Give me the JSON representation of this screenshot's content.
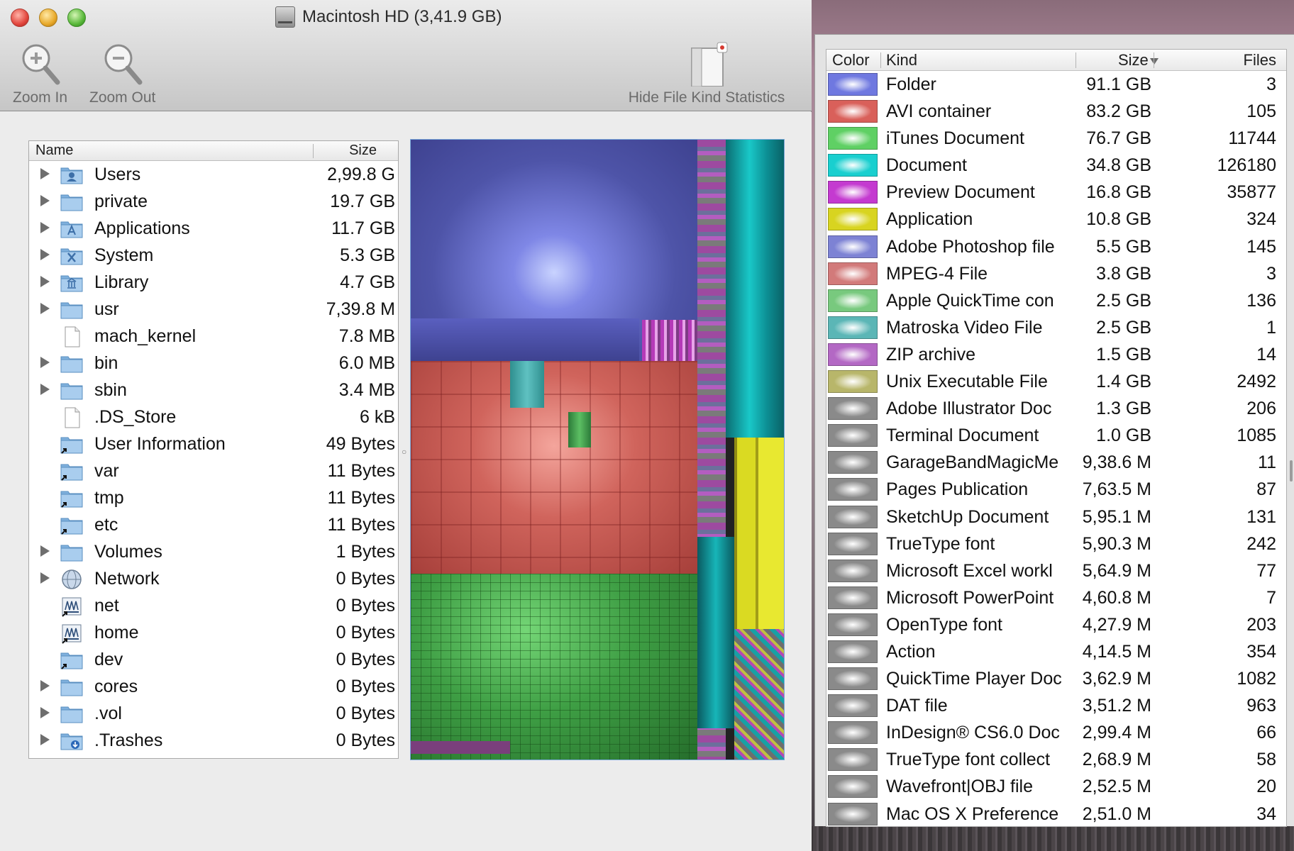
{
  "window": {
    "title": "Macintosh HD (3,41.9 GB)"
  },
  "toolbar": {
    "zoom_in_label": "Zoom In",
    "zoom_out_label": "Zoom Out",
    "hide_stats_label": "Hide File Kind Statistics"
  },
  "file_list": {
    "header_name": "Name",
    "header_size": "Size",
    "rows": [
      {
        "name": "Users",
        "size": "2,99.8 G",
        "expandable": true,
        "icon": "users-folder-icon"
      },
      {
        "name": "private",
        "size": "19.7 GB",
        "expandable": true,
        "icon": "folder-icon"
      },
      {
        "name": "Applications",
        "size": "11.7 GB",
        "expandable": true,
        "icon": "applications-folder-icon"
      },
      {
        "name": "System",
        "size": "5.3 GB",
        "expandable": true,
        "icon": "system-folder-icon"
      },
      {
        "name": "Library",
        "size": "4.7 GB",
        "expandable": true,
        "icon": "library-folder-icon"
      },
      {
        "name": "usr",
        "size": "7,39.8 M",
        "expandable": true,
        "icon": "folder-icon"
      },
      {
        "name": "mach_kernel",
        "size": "7.8 MB",
        "expandable": false,
        "icon": "document-icon"
      },
      {
        "name": "bin",
        "size": "6.0 MB",
        "expandable": true,
        "icon": "folder-icon"
      },
      {
        "name": "sbin",
        "size": "3.4 MB",
        "expandable": true,
        "icon": "folder-icon"
      },
      {
        "name": ".DS_Store",
        "size": "6 kB",
        "expandable": false,
        "icon": "document-icon"
      },
      {
        "name": "User Information",
        "size": "49 Bytes",
        "expandable": false,
        "icon": "alias-folder-icon"
      },
      {
        "name": "var",
        "size": "11 Bytes",
        "expandable": false,
        "icon": "alias-folder-icon"
      },
      {
        "name": "tmp",
        "size": "11 Bytes",
        "expandable": false,
        "icon": "alias-folder-icon"
      },
      {
        "name": "etc",
        "size": "11 Bytes",
        "expandable": false,
        "icon": "alias-folder-icon"
      },
      {
        "name": "Volumes",
        "size": "1 Bytes",
        "expandable": true,
        "icon": "folder-icon"
      },
      {
        "name": "Network",
        "size": "0 Bytes",
        "expandable": true,
        "icon": "network-globe-icon"
      },
      {
        "name": "net",
        "size": "0 Bytes",
        "expandable": false,
        "icon": "network-share-icon"
      },
      {
        "name": "home",
        "size": "0 Bytes",
        "expandable": false,
        "icon": "network-share-icon"
      },
      {
        "name": "dev",
        "size": "0 Bytes",
        "expandable": false,
        "icon": "alias-folder-icon"
      },
      {
        "name": "cores",
        "size": "0 Bytes",
        "expandable": true,
        "icon": "folder-icon"
      },
      {
        "name": ".vol",
        "size": "0 Bytes",
        "expandable": true,
        "icon": "folder-icon"
      },
      {
        "name": ".Trashes",
        "size": "0 Bytes",
        "expandable": true,
        "icon": "trash-folder-icon"
      }
    ]
  },
  "stats": {
    "header_color": "Color",
    "header_kind": "Kind",
    "header_size": "Size",
    "header_files": "Files",
    "rows": [
      {
        "color": "#6f78e0",
        "kind": "Folder",
        "size": "91.1 GB",
        "files": "3"
      },
      {
        "color": "#d9605a",
        "kind": "AVI container",
        "size": "83.2 GB",
        "files": "105"
      },
      {
        "color": "#5fd064",
        "kind": "iTunes Document",
        "size": "76.7 GB",
        "files": "11744"
      },
      {
        "color": "#19cfcf",
        "kind": "Document",
        "size": "34.8 GB",
        "files": "126180"
      },
      {
        "color": "#c43ad0",
        "kind": "Preview Document",
        "size": "16.8 GB",
        "files": "35877"
      },
      {
        "color": "#d8d420",
        "kind": "Application",
        "size": "10.8 GB",
        "files": "324"
      },
      {
        "color": "#7d82d4",
        "kind": "Adobe Photoshop file",
        "size": "5.5 GB",
        "files": "145"
      },
      {
        "color": "#d27a7a",
        "kind": "MPEG-4 File",
        "size": "3.8 GB",
        "files": "3"
      },
      {
        "color": "#78c97e",
        "kind": "Apple QuickTime con",
        "size": "2.5 GB",
        "files": "136"
      },
      {
        "color": "#5bb6b6",
        "kind": "Matroska Video File",
        "size": "2.5 GB",
        "files": "1"
      },
      {
        "color": "#b368c4",
        "kind": "ZIP archive",
        "size": "1.5 GB",
        "files": "14"
      },
      {
        "color": "#b8b66a",
        "kind": "Unix Executable File",
        "size": "1.4 GB",
        "files": "2492"
      },
      {
        "color": "#8a8a8a",
        "kind": "Adobe Illustrator Doc",
        "size": "1.3 GB",
        "files": "206"
      },
      {
        "color": "#8a8a8a",
        "kind": "Terminal Document",
        "size": "1.0 GB",
        "files": "1085"
      },
      {
        "color": "#8a8a8a",
        "kind": "GarageBandMagicMe",
        "size": "9,38.6 M",
        "files": "11"
      },
      {
        "color": "#8a8a8a",
        "kind": "Pages Publication",
        "size": "7,63.5 M",
        "files": "87"
      },
      {
        "color": "#8a8a8a",
        "kind": "SketchUp Document",
        "size": "5,95.1 M",
        "files": "131"
      },
      {
        "color": "#8a8a8a",
        "kind": "TrueType font",
        "size": "5,90.3 M",
        "files": "242"
      },
      {
        "color": "#8a8a8a",
        "kind": "Microsoft Excel workl",
        "size": "5,64.9 M",
        "files": "77"
      },
      {
        "color": "#8a8a8a",
        "kind": "Microsoft PowerPoint",
        "size": "4,60.8 M",
        "files": "7"
      },
      {
        "color": "#8a8a8a",
        "kind": "OpenType font",
        "size": "4,27.9 M",
        "files": "203"
      },
      {
        "color": "#8a8a8a",
        "kind": "Action",
        "size": "4,14.5 M",
        "files": "354"
      },
      {
        "color": "#8a8a8a",
        "kind": "QuickTime Player Doc",
        "size": "3,62.9 M",
        "files": "1082"
      },
      {
        "color": "#8a8a8a",
        "kind": "DAT file",
        "size": "3,51.2 M",
        "files": "963"
      },
      {
        "color": "#8a8a8a",
        "kind": "InDesign® CS6.0 Doc",
        "size": "2,99.4 M",
        "files": "66"
      },
      {
        "color": "#8a8a8a",
        "kind": "TrueType font collect",
        "size": "2,68.9 M",
        "files": "58"
      },
      {
        "color": "#8a8a8a",
        "kind": "Wavefront|OBJ file",
        "size": "2,52.5 M",
        "files": "20"
      },
      {
        "color": "#8a8a8a",
        "kind": "Mac OS X Preference",
        "size": "2,51.0 M",
        "files": "34"
      }
    ]
  }
}
